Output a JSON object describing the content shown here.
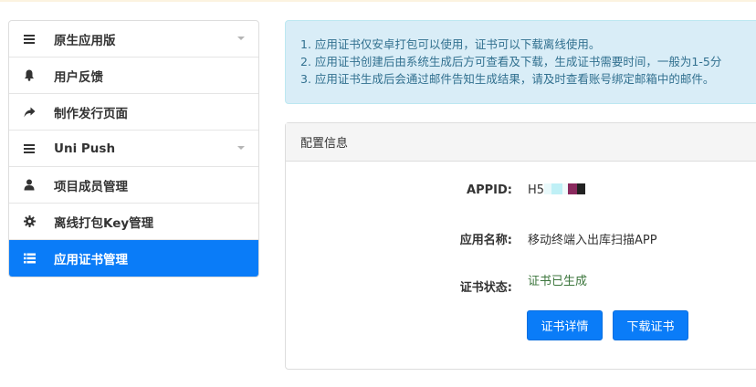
{
  "sidebar": {
    "items": [
      {
        "label": "原生应用版",
        "icon": "bars-icon",
        "has_caret": true,
        "active": false
      },
      {
        "label": "用户反馈",
        "icon": "bell-icon",
        "has_caret": false,
        "active": false
      },
      {
        "label": "制作发行页面",
        "icon": "share-arrow-icon",
        "has_caret": false,
        "active": false
      },
      {
        "label": "Uni Push",
        "icon": "bars-icon",
        "has_caret": true,
        "active": false
      },
      {
        "label": "项目成员管理",
        "icon": "user-icon",
        "has_caret": false,
        "active": false
      },
      {
        "label": "离线打包Key管理",
        "icon": "gear-icon",
        "has_caret": false,
        "active": false
      },
      {
        "label": "应用证书管理",
        "icon": "list-icon",
        "has_caret": false,
        "active": true
      }
    ]
  },
  "notice": {
    "lines": [
      "1. 应用证书仅安卓打包可以使用，证书可以下载离线使用。",
      "2. 应用证书创建后由系统生成后方可查看及下载，生成证书需要时间，一般为1-5分",
      "3. 应用证书生成后会通过邮件告知生成结果，请及时查看账号绑定邮箱中的邮件。"
    ]
  },
  "panel": {
    "title": "配置信息",
    "appid_label": "APPID:",
    "appid_value": "H5",
    "appname_label": "应用名称:",
    "appname_value": "移动终端入出库扫描APP",
    "status_label": "证书状态:",
    "status_value": "证书已生成",
    "details_button": "证书详情",
    "download_button": "下载证书"
  },
  "colors": {
    "primary": "#0a7cf8",
    "alert_bg": "#d9edf7",
    "alert_text": "#31708f",
    "success_text": "#3c763d"
  }
}
